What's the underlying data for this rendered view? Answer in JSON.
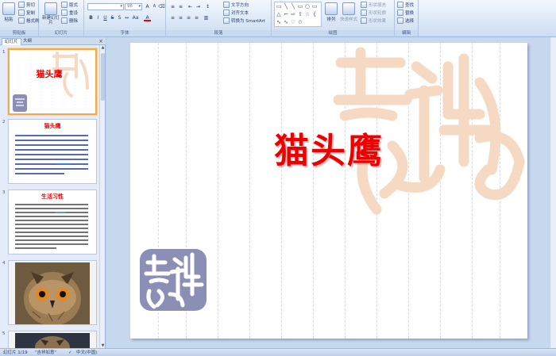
{
  "ribbon": {
    "clipboard": {
      "label": "剪贴板",
      "paste": "粘贴",
      "cut": "剪切",
      "copy": "复制",
      "format_painter": "格式刷"
    },
    "slides": {
      "label": "幻灯片",
      "new_slide": "新建幻灯片",
      "layout": "版式",
      "reset": "重设",
      "delete": "删除"
    },
    "font": {
      "label": "字体",
      "font_size": "96"
    },
    "paragraph": {
      "label": "段落",
      "text_direction": "文字方向",
      "align_text": "对齐文本",
      "convert_smartart": "转换为 SmartArt"
    },
    "drawing": {
      "label": "绘图",
      "arrange": "排列",
      "quick_styles": "快速样式",
      "shape_fill": "形状填充",
      "shape_outline": "形状轮廓",
      "shape_effects": "形状效果"
    },
    "editing": {
      "label": "编辑",
      "find": "查找",
      "replace": "替换",
      "select": "选择"
    }
  },
  "left_pane": {
    "tabs": {
      "slides": "幻灯片",
      "outline": "大纲",
      "close": "×"
    },
    "thumbnails": [
      {
        "num": "1",
        "title": "猫头鹰"
      },
      {
        "num": "2",
        "title": "猫头鹰"
      },
      {
        "num": "3",
        "title": "生活习性"
      },
      {
        "num": "4"
      },
      {
        "num": "5"
      }
    ]
  },
  "slide": {
    "title": "猫头鹰"
  },
  "status_bar": {
    "slide_info": "幻灯片 1/19",
    "theme": "\"吉祥如意\"",
    "language": "中文(中国)"
  },
  "colors": {
    "title_red": "#ee0000",
    "watermark": "#f6d9c3",
    "seal": "#8c8fb5",
    "selection": "#f5a94a"
  }
}
